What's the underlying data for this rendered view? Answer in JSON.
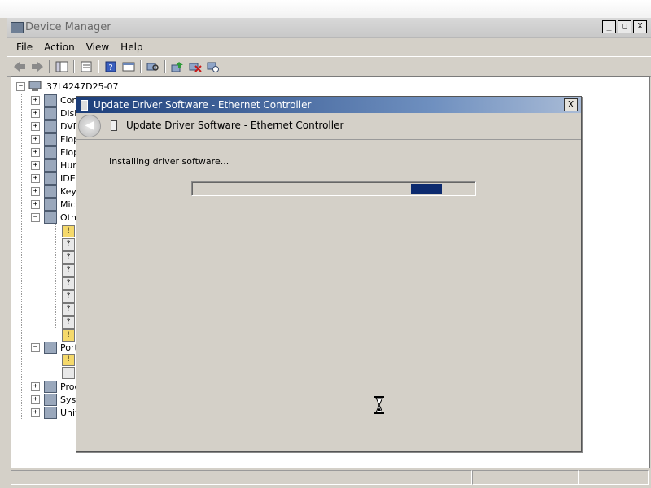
{
  "window": {
    "title": "Device Manager",
    "controls": [
      "_",
      "□",
      "X"
    ]
  },
  "menu": [
    "File",
    "Action",
    "View",
    "Help"
  ],
  "tree": {
    "root": "37L4247D25-07",
    "categories": [
      "Com",
      "Disk",
      "DVD",
      "Flop",
      "Flop",
      "Hum",
      "IDE",
      "Key",
      "Mic",
      "Othe",
      "Port",
      "Proc",
      "Syst",
      "Univ"
    ]
  },
  "dialog": {
    "title": "Update Driver Software - Ethernet Controller",
    "header": "Update Driver Software - Ethernet Controller",
    "instruction": "Installing driver software...",
    "close_label": "X",
    "progress_fraction": 0.88
  },
  "icons": [
    "device-manager-icon",
    "back-icon",
    "forward-icon",
    "properties-icon",
    "help-icon",
    "scan-icon",
    "update-driver-icon",
    "uninstall-icon",
    "disable-icon",
    "hourglass-icon"
  ]
}
